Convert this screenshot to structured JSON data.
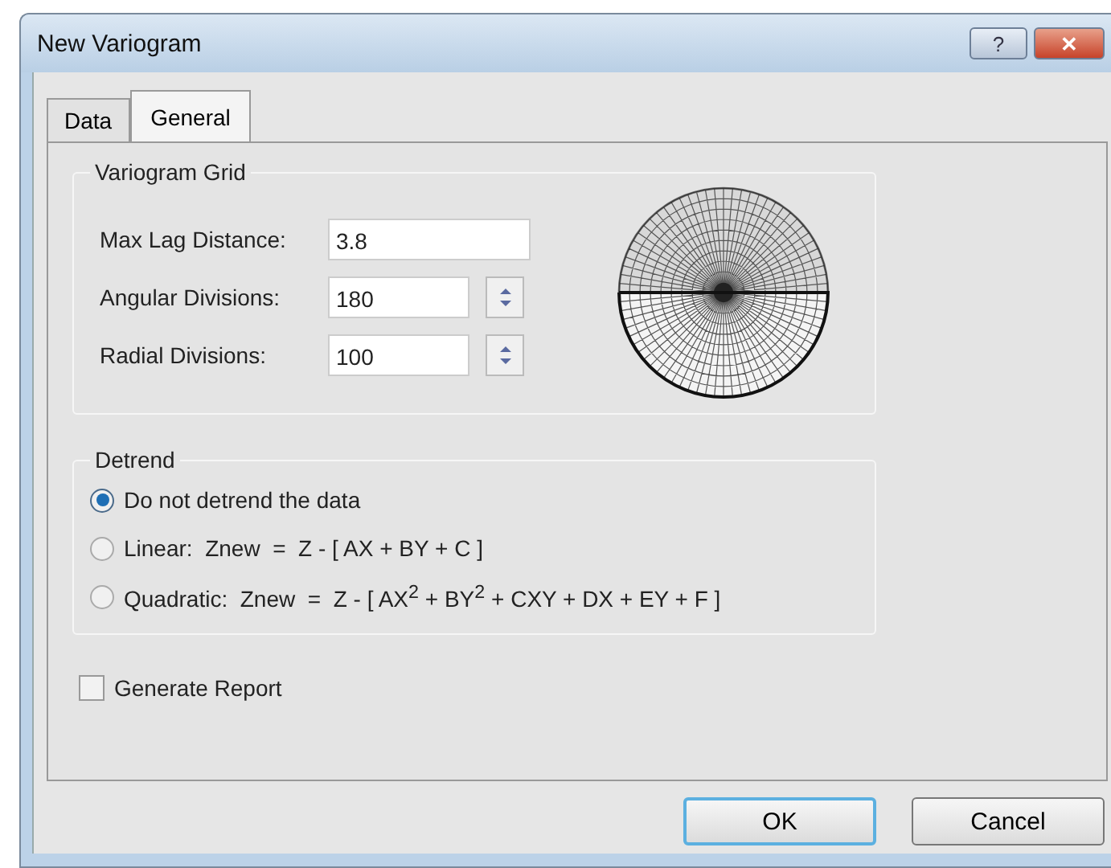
{
  "window": {
    "title": "New Variogram"
  },
  "title_buttons": [
    {
      "kind": "help",
      "label": "?"
    },
    {
      "kind": "close",
      "label": "✕"
    }
  ],
  "tabs": [
    {
      "label": "Data",
      "selected": false
    },
    {
      "label": "General",
      "selected": true
    }
  ],
  "variogram_grid": {
    "title": "Variogram Grid",
    "fields": [
      {
        "kind": "text",
        "label": "Max Lag Distance:",
        "value": "3.8"
      },
      {
        "kind": "spin",
        "label": "Angular Divisions:",
        "value": "180"
      },
      {
        "kind": "spin",
        "label": "Radial Divisions:",
        "value": "100"
      }
    ]
  },
  "detrend": {
    "title": "Detrend",
    "options": [
      {
        "label": "Do not detrend the data",
        "selected": true
      },
      {
        "label": "Linear:  Znew  =  Z - [ AX + BY + C ]",
        "selected": false
      },
      {
        "label": "Quadratic:  Znew  =  Z - [ AX$^{2}$ + BY$^{2}$ + CXY + DX + EY + F ]",
        "selected": false
      }
    ]
  },
  "generate_report": {
    "label": "Generate Report",
    "checked": false
  },
  "buttons": [
    {
      "label": "OK",
      "kind": "default"
    },
    {
      "label": "Cancel",
      "kind": "normal"
    }
  ]
}
